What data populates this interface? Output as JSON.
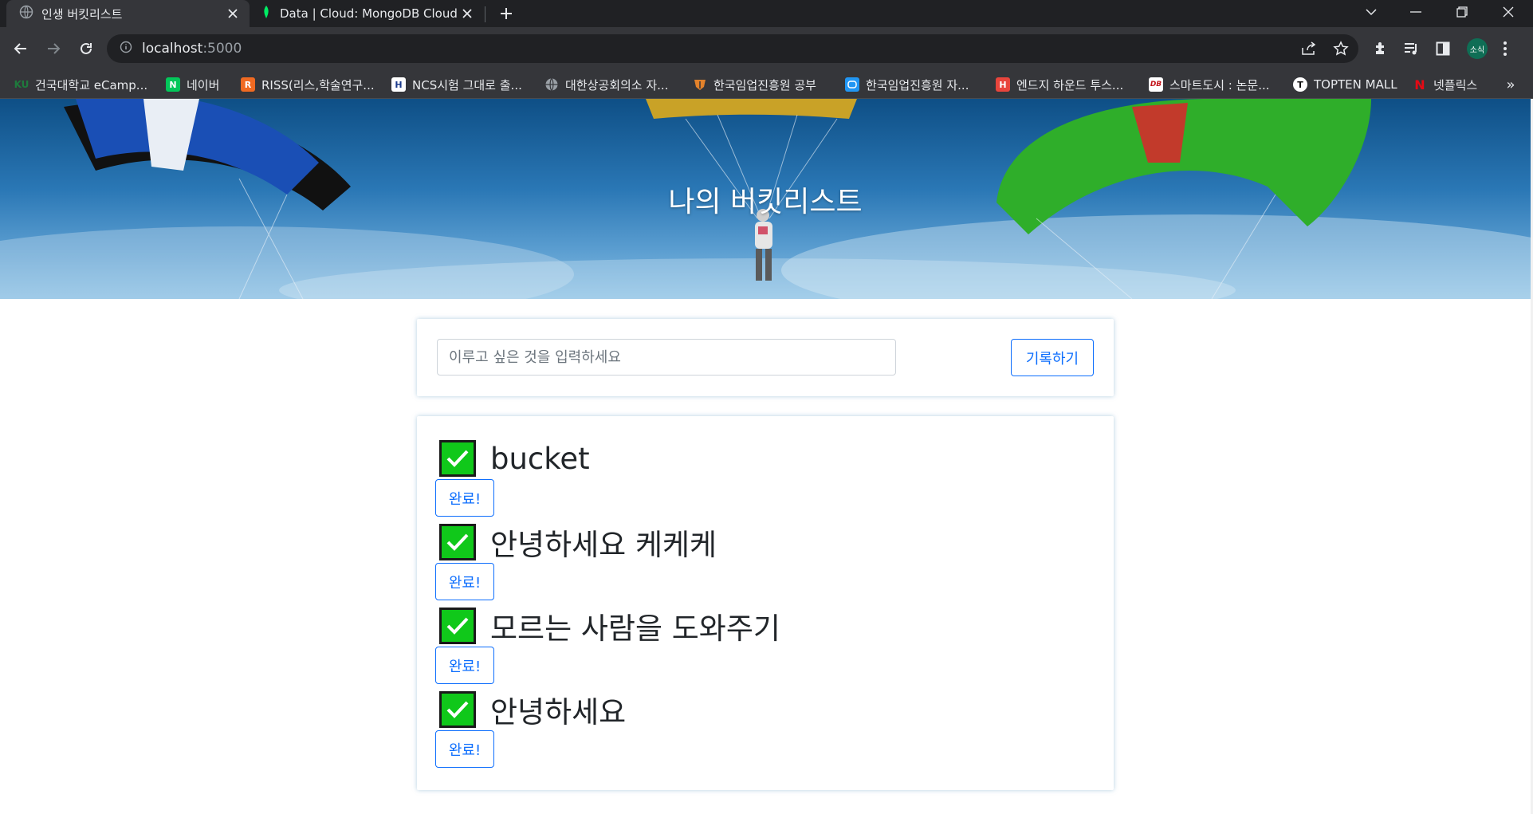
{
  "browser": {
    "tabs": [
      {
        "title": "인생 버킷리스트",
        "active": true
      },
      {
        "title": "Data | Cloud: MongoDB Cloud",
        "active": false
      }
    ],
    "address": {
      "host": "localhost",
      "port": ":5000"
    },
    "profile_initials": "소식",
    "bookmarks": [
      {
        "label": "건국대학교 eCamp...",
        "fav_text": "KU",
        "fav_color": "#1e7b3c"
      },
      {
        "label": "네이버",
        "fav_text": "N",
        "fav_color": "#03c75a"
      },
      {
        "label": "RISS(리스,학술연구...",
        "fav_text": "R",
        "fav_color": "#f06a22"
      },
      {
        "label": "NCS시험 그대로 출...",
        "fav_text": "H",
        "fav_color": "#1b3a8c"
      },
      {
        "label": "대한상공회의소 자...",
        "fav_text": "",
        "fav_color": "#5f6368"
      },
      {
        "label": "한국임업진흥원 공부",
        "fav_text": "",
        "fav_color": "#e3822b"
      },
      {
        "label": "한국임업진흥원 자...",
        "fav_text": "",
        "fav_color": "#2196f3"
      },
      {
        "label": "엔드지 하운드 투스...",
        "fav_text": "H",
        "fav_color": "#e8453c"
      },
      {
        "label": "스마트도시 : 논문...",
        "fav_text": "DB",
        "fav_color": "#ffffff"
      },
      {
        "label": "TOPTEN MALL",
        "fav_text": "T",
        "fav_color": "#111111"
      },
      {
        "label": "넷플릭스",
        "fav_text": "N",
        "fav_color": "#e50914"
      }
    ]
  },
  "page": {
    "title": "나의 버킷리스트",
    "input_placeholder": "이루고 싶은 것을 입력하세요",
    "record_button": "기록하기",
    "done_button": "완료!",
    "buckets": [
      "bucket",
      "안녕하세요 케케케",
      "모르는 사람을 도와주기",
      "안녕하세요"
    ]
  },
  "colors": {
    "accent": "#0d6efd",
    "check_green": "#10c81a"
  }
}
